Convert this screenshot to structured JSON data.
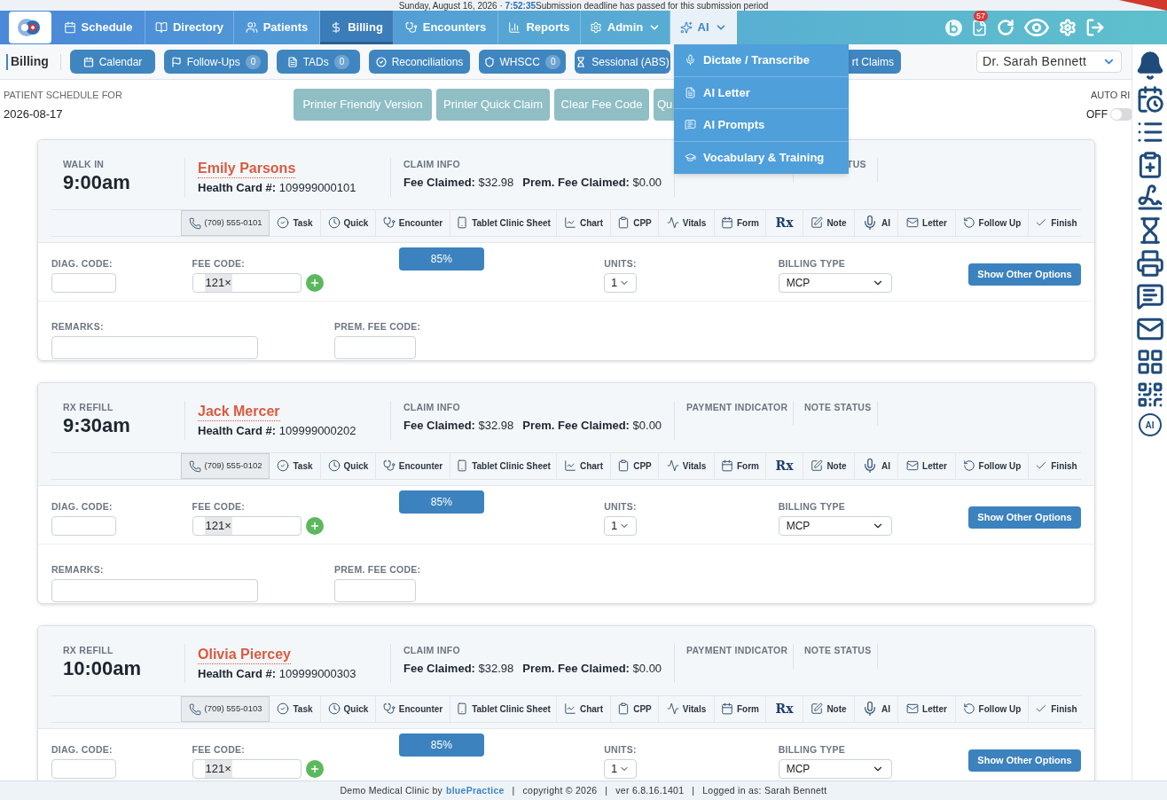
{
  "top_strip": {
    "date": "Sunday, August 16, 2026 ·",
    "time": "7:52:35",
    "notice": "Submission deadline has passed for this submission period"
  },
  "nav": {
    "tabs": [
      {
        "label": "Schedule",
        "selected": false
      },
      {
        "label": "Directory",
        "selected": false
      },
      {
        "label": "Patients",
        "selected": false
      },
      {
        "label": "Billing",
        "selected": true
      },
      {
        "label": "Encounters",
        "selected": false
      },
      {
        "label": "Reports",
        "selected": false
      },
      {
        "label": "Admin",
        "selected": false,
        "open": false
      },
      {
        "label": "AI",
        "selected": false,
        "open": true
      }
    ],
    "notification_count": "57"
  },
  "ai_menu": {
    "items": [
      "Dictate / Transcribe",
      "AI Letter",
      "AI Prompts",
      "Vocabulary & Training"
    ]
  },
  "subnav": {
    "title": "Billing",
    "buttons": [
      {
        "label": "Calendar"
      },
      {
        "label": "Follow-Ups",
        "count": "0"
      },
      {
        "label": "TADs",
        "count": "0"
      },
      {
        "label": "Reconciliations"
      },
      {
        "label": "WHSCC",
        "count": "0"
      },
      {
        "label": "Sessional (ABS)"
      },
      {
        "label": "rt Claims"
      }
    ],
    "provider": "Dr. Sarah Bennett"
  },
  "schedule": {
    "label": "PATIENT SCHEDULE FOR",
    "date": "2026-08-17",
    "buttons": [
      "Printer Friendly Version",
      "Printer Quick Claim",
      "Clear Fee Code",
      "Qu"
    ],
    "auto_refresh": {
      "label": "AUTO RI",
      "state_text": "OFF",
      "on": false
    }
  },
  "appointments": [
    {
      "visit_type": "WALK IN",
      "time": "9:00am",
      "patient": "Emily Parsons",
      "health_card": "**Health Card #:** 109999000101",
      "claim_label": "CLAIM INFO",
      "fee_claimed": "**Fee Claimed:** $32.98",
      "prem_fee_claimed": "**Prem. Fee Claimed:** $0.00",
      "note_status_label": "TUS",
      "actions": [
        {
          "kind": "phone",
          "label": "(709) 555-0101"
        },
        {
          "kind": "action",
          "label": "Task"
        },
        {
          "kind": "action",
          "label": "Quick"
        },
        {
          "kind": "action",
          "label": "Encounter"
        },
        {
          "kind": "action",
          "label": "Tablet Clinic Sheet"
        },
        {
          "kind": "action",
          "label": "Chart"
        },
        {
          "kind": "action",
          "label": "CPP"
        },
        {
          "kind": "action",
          "label": "Vitals"
        },
        {
          "kind": "action",
          "label": "Form"
        },
        {
          "kind": "glyph",
          "label": "Rx"
        },
        {
          "kind": "action",
          "label": "Note"
        },
        {
          "kind": "action",
          "label": "AI"
        },
        {
          "kind": "action",
          "label": "Letter"
        },
        {
          "kind": "action",
          "label": "Follow Up"
        },
        {
          "kind": "action",
          "label": "Finish"
        }
      ],
      "diag_label": "DIAG. CODE:",
      "fee_label": "FEE CODE:",
      "fee_tag": "121×",
      "progress": "85%",
      "units_label": "UNITS:",
      "units": "1",
      "billing_label": "BILLING TYPE",
      "billing_type": "MCP",
      "options_button": "Show Other Options",
      "remarks_label": "REMARKS:",
      "prem_fee_label": "PREM. FEE CODE:"
    },
    {
      "visit_type": "RX REFILL",
      "time": "9:30am",
      "patient": "Jack Mercer",
      "health_card": "**Health Card #:** 109999000202",
      "claim_label": "CLAIM INFO",
      "fee_claimed": "**Fee Claimed:** $32.98",
      "prem_fee_claimed": "**Prem. Fee Claimed:** $0.00",
      "payment_label": "PAYMENT INDICATOR",
      "note_status_label": "NOTE STATUS",
      "actions": [
        {
          "kind": "phone",
          "label": "(709) 555-0102"
        },
        {
          "kind": "action",
          "label": "Task"
        },
        {
          "kind": "action",
          "label": "Quick"
        },
        {
          "kind": "action",
          "label": "Encounter"
        },
        {
          "kind": "action",
          "label": "Tablet Clinic Sheet"
        },
        {
          "kind": "action",
          "label": "Chart"
        },
        {
          "kind": "action",
          "label": "CPP"
        },
        {
          "kind": "action",
          "label": "Vitals"
        },
        {
          "kind": "action",
          "label": "Form"
        },
        {
          "kind": "glyph",
          "label": "Rx"
        },
        {
          "kind": "action",
          "label": "Note"
        },
        {
          "kind": "action",
          "label": "AI"
        },
        {
          "kind": "action",
          "label": "Letter"
        },
        {
          "kind": "action",
          "label": "Follow Up"
        },
        {
          "kind": "action",
          "label": "Finish"
        }
      ],
      "diag_label": "DIAG. CODE:",
      "fee_label": "FEE CODE:",
      "fee_tag": "121×",
      "progress": "85%",
      "units_label": "UNITS:",
      "units": "1",
      "billing_label": "BILLING TYPE",
      "billing_type": "MCP",
      "options_button": "Show Other Options",
      "remarks_label": "REMARKS:",
      "prem_fee_label": "PREM. FEE CODE:"
    },
    {
      "visit_type": "RX REFILL",
      "time": "10:00am",
      "patient": "Olivia Piercey",
      "health_card": "**Health Card #:** 109999000303",
      "claim_label": "CLAIM INFO",
      "fee_claimed": "**Fee Claimed:** $32.98",
      "prem_fee_claimed": "**Prem. Fee Claimed:** $0.00",
      "payment_label": "PAYMENT INDICATOR",
      "note_status_label": "NOTE STATUS",
      "actions": [
        {
          "kind": "phone",
          "label": "(709) 555-0103"
        },
        {
          "kind": "action",
          "label": "Task"
        },
        {
          "kind": "action",
          "label": "Quick"
        },
        {
          "kind": "action",
          "label": "Encounter"
        },
        {
          "kind": "action",
          "label": "Tablet Clinic Sheet"
        },
        {
          "kind": "action",
          "label": "Chart"
        },
        {
          "kind": "action",
          "label": "CPP"
        },
        {
          "kind": "action",
          "label": "Vitals"
        },
        {
          "kind": "action",
          "label": "Form"
        },
        {
          "kind": "glyph",
          "label": "Rx"
        },
        {
          "kind": "action",
          "label": "Note"
        },
        {
          "kind": "action",
          "label": "AI"
        },
        {
          "kind": "action",
          "label": "Letter"
        },
        {
          "kind": "action",
          "label": "Follow Up"
        },
        {
          "kind": "action",
          "label": "Finish"
        }
      ],
      "diag_label": "DIAG. CODE:",
      "fee_label": "FEE CODE:",
      "fee_tag": "121×",
      "progress": "85%",
      "units_label": "UNITS:",
      "units": "1",
      "billing_label": "BILLING TYPE",
      "billing_type": "MCP",
      "options_button": "Show Other Options"
    }
  ],
  "sidebar": {
    "ai_label": "AI"
  },
  "footer": {
    "clinic": "Demo Medical Clinic by",
    "brand": "bluePractice",
    "separator": "|",
    "items": [
      "copyright © 2026",
      "ver 6.8.16.1401",
      "Logged in as: Sarah Bennett"
    ]
  }
}
